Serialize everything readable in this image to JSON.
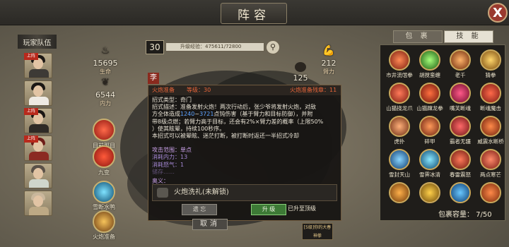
{
  "header": {
    "title": "阵容",
    "close_label": "X"
  },
  "left": {
    "team_label": "玩家队伍",
    "tags": [
      "上阵",
      "上阵",
      "上阵"
    ],
    "hp_value": "15695",
    "hp_label": "生命",
    "mp_value": "6544",
    "mp_label": "内力",
    "skills": [
      {
        "name": "目前那目"
      },
      {
        "name": "九变"
      },
      {
        "name": "雪断水鸭"
      },
      {
        "name": "火炮准备"
      }
    ],
    "level": "30",
    "exp_text": "升级经验：475611/72800"
  },
  "center": {
    "stat_value": "125",
    "stat_char": "李",
    "power_value": "212",
    "power_label": "臂力"
  },
  "right": {
    "tab_bag": "包 裹",
    "tab_skill": "技 能",
    "skills": [
      "市井流氓拳",
      "胡搅蛮缠",
      "老千",
      "猜拳",
      "山猫挠龙爪",
      "山猫蹿龙拳",
      "嘴芙断魂",
      "断魂魔击",
      "虎扑",
      "碎甲",
      "霸者无疆",
      "威震水断桥",
      "雪封天山",
      "雪霁冰清",
      "春雷震怒",
      "两点寒芒",
      "",
      "",
      "",
      ""
    ],
    "capacity": "包裹容量： 7/50"
  },
  "popup": {
    "name": "火炮准备",
    "level": "等级：30",
    "cooldown": "火炮准备残章：11",
    "type": "招式类型：奇门",
    "desc_1": "招式描述：准备发射火炮！两次行动后，张少爷将发射火炮，对敌",
    "desc_2a": "方全体造成",
    "dmg_low": "1240",
    "desc_arrow": "~",
    "dmg_high": "3721",
    "desc_2b": "点钝伤害（基于臂力和目标防御），并附",
    "desc_3": "带8级点燃；若臂力高于目标，还会有2%×臂力差的概率（上限50%",
    "desc_4": "）使其眩晕，持续100秒序。",
    "desc_5": "本招式可以被晕眩、迷茫打断，被打断时返还一半招式冷却",
    "range": "攻击范围：单点",
    "cost_mp": "消耗内力：13",
    "cost_rage": "消耗怒气：1",
    "cut_line": "储存……",
    "aoyi": "奥义：",
    "ult_name": "火炮洗礼(未解锁)",
    "btn_left": "遗 忘",
    "btn_upgrade": "升 级",
    "maxed": "已升至顶级",
    "cancel": "取消",
    "chip": "[5级]你的大春神拳"
  },
  "colors": {
    "accent_red": "#e8653a",
    "accent_blue": "#5fa3ff",
    "upgrade_green": "#3d7a36"
  }
}
